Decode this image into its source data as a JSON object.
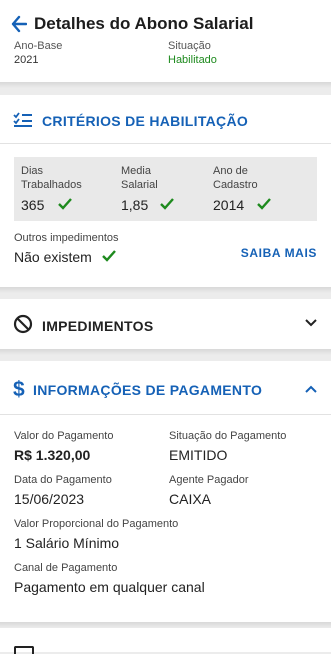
{
  "header": {
    "title": "Detalhes do Abono Salarial",
    "ano_base_label": "Ano-Base",
    "ano_base_value": "2021",
    "situacao_label": "Situação",
    "situacao_value": "Habilitado"
  },
  "criterios": {
    "title": "CRITÉRIOS DE HABILITAÇÃO",
    "items": [
      {
        "label_line1": "Dias",
        "label_line2": "Trabalhados",
        "value": "365"
      },
      {
        "label_line1": "Media",
        "label_line2": "Salarial",
        "value": "1,85"
      },
      {
        "label_line1": "Ano de",
        "label_line2": "Cadastro",
        "value": "2014"
      }
    ],
    "outros_label": "Outros impedimentos",
    "outros_value": "Não existem",
    "saiba_mais": "SAIBA MAIS"
  },
  "impedimentos": {
    "title": "IMPEDIMENTOS"
  },
  "pagamento": {
    "title": "INFORMAÇÕES DE PAGAMENTO",
    "valor_label": "Valor do Pagamento",
    "valor_value": "R$ 1.320,00",
    "situacao_label": "Situação do Pagamento",
    "situacao_value": "EMITIDO",
    "data_label": "Data do Pagamento",
    "data_value": "15/06/2023",
    "agente_label": "Agente Pagador",
    "agente_value": "CAIXA",
    "proporcional_label": "Valor Proporcional do Pagamento",
    "proporcional_value": "1 Salário Mínimo",
    "canal_label": "Canal de Pagamento",
    "canal_value": "Pagamento em qualquer canal"
  },
  "colors": {
    "accent": "#1561b6",
    "success": "#1e8a1e"
  }
}
